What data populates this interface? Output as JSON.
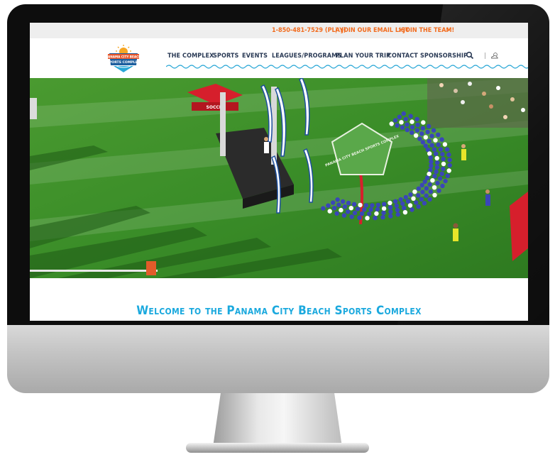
{
  "topbar": {
    "phone": "1-850-481-7529 (PLAY)",
    "separator": "|",
    "email_link": "JOIN OUR EMAIL LIST",
    "email_arrow": ">",
    "team_link": "JOIN THE TEAM!",
    "team_arrow": ">"
  },
  "logo": {
    "line1": "PANAMA CITY BEACH",
    "line2": "SPORTS COMPLEX"
  },
  "nav": {
    "items": [
      {
        "label": "THE COMPLEX"
      },
      {
        "label": "SPORTS"
      },
      {
        "label": "EVENTS"
      },
      {
        "label": "LEAGUES/PROGRAMS"
      },
      {
        "label": "PLAN YOUR TRIP"
      },
      {
        "label": "CONTACT"
      },
      {
        "label": "SPONSORSHIP"
      }
    ],
    "search_icon": "search-icon",
    "divider": "|",
    "weather_icon": "weather-icon"
  },
  "hero": {
    "banner_text": "SOCCER",
    "field_logo_text": "PANAMA CITY BEACH SPORTS COMPLEX"
  },
  "main": {
    "welcome_heading": "Welcome to the Panama City Beach Sports Complex"
  },
  "colors": {
    "accent_orange": "#f26b1d",
    "nav_text": "#2a3a55",
    "heading_blue": "#1ba9de",
    "turf_green": "#3a8d28"
  }
}
